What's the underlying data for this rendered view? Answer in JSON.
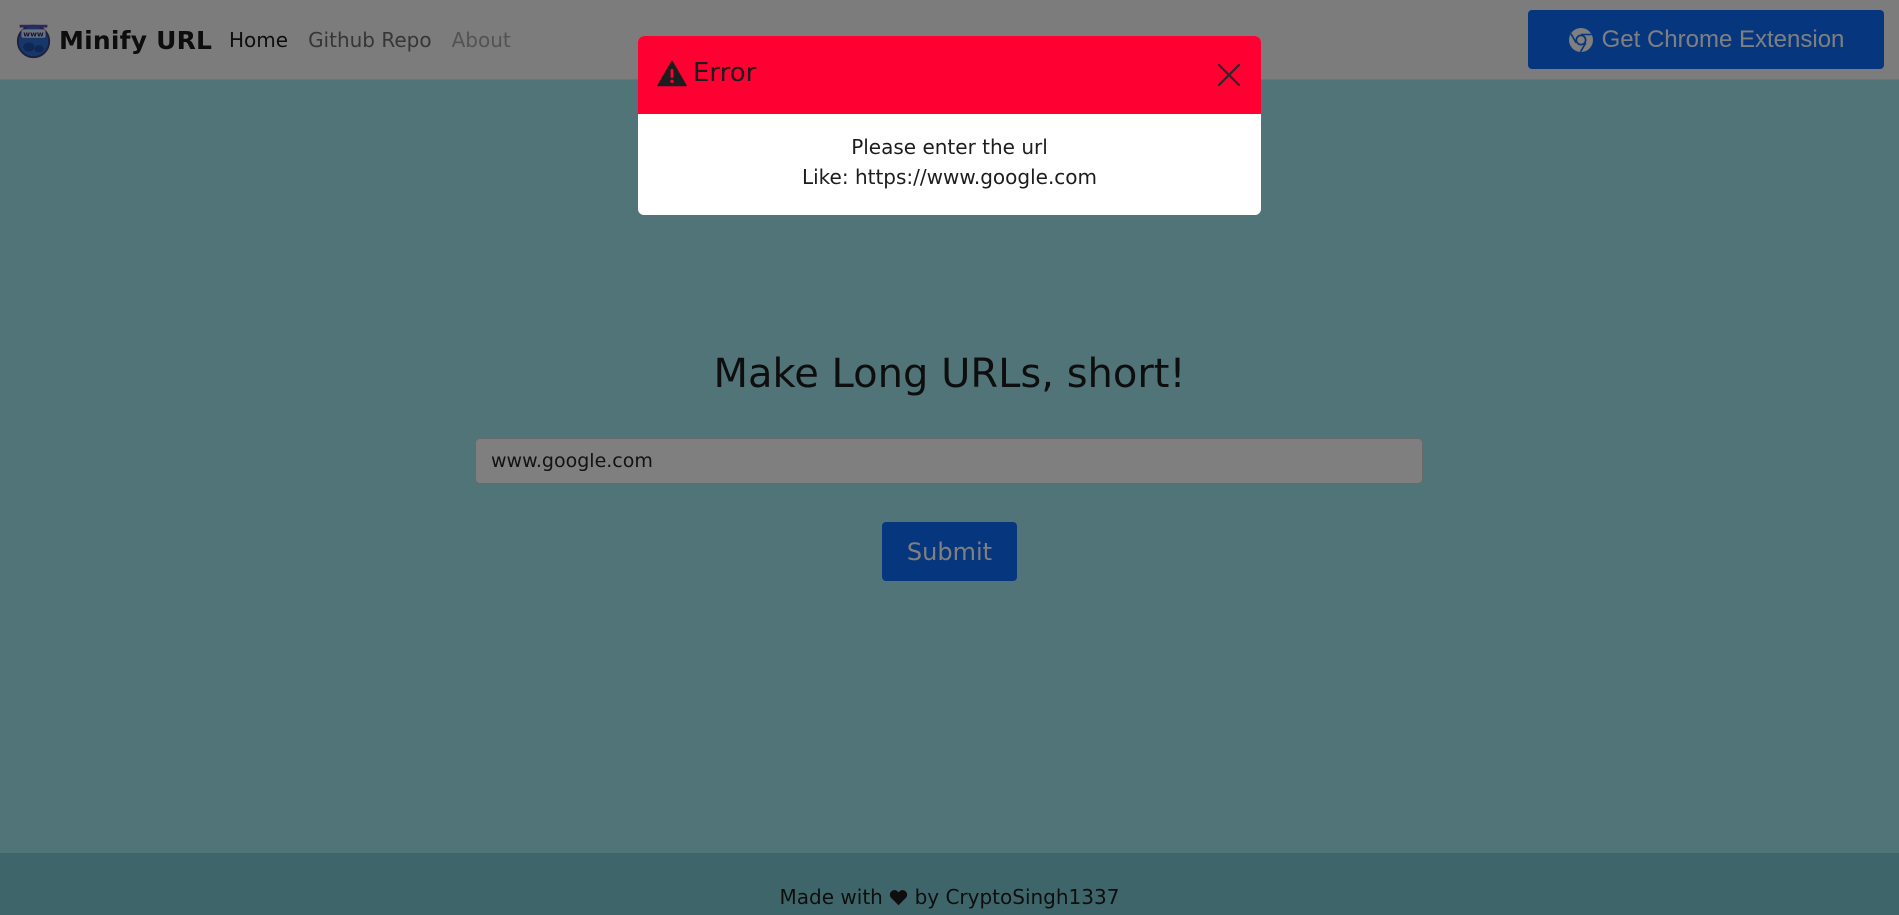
{
  "navbar": {
    "brand": "Minify URL",
    "links": [
      {
        "label": "Home"
      },
      {
        "label": "Github Repo"
      },
      {
        "label": "About"
      }
    ],
    "chrome_button": "Get Chrome Extension"
  },
  "main": {
    "title": "Make Long URLs, short!",
    "url_input_value": "www.google.com",
    "submit_label": "Submit"
  },
  "footer": {
    "prefix": "Made with",
    "suffix": "by CryptoSingh1337"
  },
  "modal": {
    "title": "Error",
    "line1": "Please enter the url",
    "line2": "Like: https://www.google.com"
  },
  "colors": {
    "background": "#a3e9f0",
    "navbar": "#f8f9fa",
    "primary": "#0d6efd",
    "footer": "#7ccdd4",
    "error_header": "#ff0033"
  },
  "icons": {
    "brand_logo": "globe-www-icon",
    "chrome": "chrome-icon",
    "warning": "warning-triangle-icon",
    "close": "close-icon",
    "heart": "heart-icon"
  }
}
